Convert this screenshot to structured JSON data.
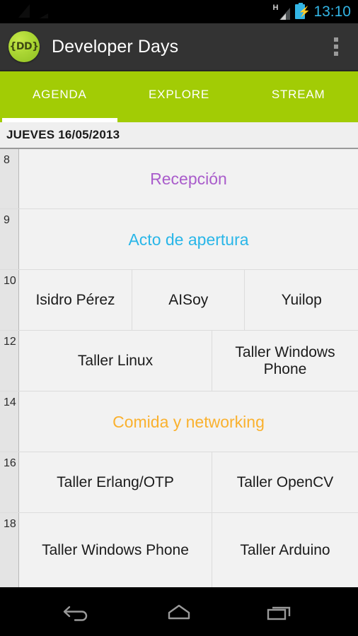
{
  "status_bar": {
    "network_type": "H",
    "signal_icon": "signal-bars-icon",
    "battery_icon": "battery-charging-icon",
    "battery_bolt": "⚡",
    "time": "13:10",
    "accent_color": "#33b5e5"
  },
  "action_bar": {
    "logo_text": "{DD}",
    "logo_icon": "app-logo-icon",
    "title": "Developer Days",
    "overflow_icon": "overflow-menu-icon",
    "background_color": "#333333"
  },
  "tabs": {
    "accent_color": "#a2cc05",
    "active_index": 0,
    "items": [
      {
        "label": "AGENDA"
      },
      {
        "label": "EXPLORE"
      },
      {
        "label": "STREAM"
      }
    ]
  },
  "date_header": {
    "label": "JUEVES 16/05/2013"
  },
  "agenda": {
    "colors": {
      "purple": "#a95ccb",
      "cyan": "#29b6e8",
      "orange": "#fab12e",
      "default": "#1b1b1b"
    },
    "rows": [
      {
        "hour": "8",
        "height": 85,
        "slots": [
          {
            "title": "Recepción",
            "accent": "purple",
            "width": 100
          }
        ]
      },
      {
        "hour": "9",
        "height": 86,
        "slots": [
          {
            "title": "Acto de apertura",
            "accent": "cyan",
            "width": 100
          }
        ]
      },
      {
        "hour": "10",
        "height": 86,
        "slots": [
          {
            "title": "Isidro Pérez",
            "accent": "default",
            "width": 33.4
          },
          {
            "title": "AISoy",
            "accent": "default",
            "width": 33.3
          },
          {
            "title": "Yuilop",
            "accent": "default",
            "width": 33.3
          }
        ]
      },
      {
        "hour": "12",
        "height": 86,
        "slots": [
          {
            "title": "Taller Linux",
            "accent": "default",
            "width": 57
          },
          {
            "title": "Taller Windows Phone",
            "accent": "default",
            "width": 43
          }
        ]
      },
      {
        "hour": "14",
        "height": 86,
        "slots": [
          {
            "title": "Comida y networking",
            "accent": "orange",
            "width": 100
          }
        ]
      },
      {
        "hour": "16",
        "height": 86,
        "slots": [
          {
            "title": "Taller Erlang/OTP",
            "accent": "default",
            "width": 57
          },
          {
            "title": "Taller OpenCV",
            "accent": "default",
            "width": 43
          }
        ]
      },
      {
        "hour": "18",
        "height": 105,
        "slots": [
          {
            "title": "Taller Windows Phone",
            "accent": "default",
            "width": 57
          },
          {
            "title": "Taller Arduino",
            "accent": "default",
            "width": 43
          }
        ]
      }
    ]
  },
  "nav_bar": {
    "buttons": [
      {
        "name": "back-icon",
        "label": "Back"
      },
      {
        "name": "home-icon",
        "label": "Home"
      },
      {
        "name": "recents-icon",
        "label": "Recents"
      }
    ]
  }
}
